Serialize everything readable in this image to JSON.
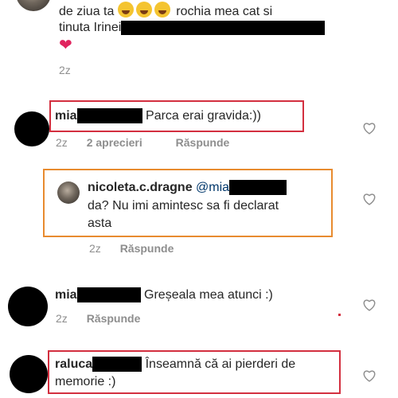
{
  "top_comment": {
    "line1_prefix": "de ziua ta",
    "line1_suffix": "rochia mea cat si",
    "line2": "tinuta Irinei",
    "heart": "❤",
    "time": "2z"
  },
  "comment_mia_1": {
    "username": "mia",
    "text": "Parca erai gravida:))",
    "time": "2z",
    "likes": "2 aprecieri",
    "reply": "Răspunde"
  },
  "reply_nicoleta": {
    "username": "nicoleta.c.dragne",
    "mention": "@mia",
    "line2": "da? Nu imi amintesc sa fi declarat",
    "line3": "asta",
    "time": "2z",
    "reply": "Răspunde"
  },
  "comment_mia_2": {
    "username": "mia",
    "text": "Greșeala mea atunci :)",
    "time": "2z",
    "reply": "Răspunde"
  },
  "comment_raluca": {
    "username": "raluca",
    "text_line1": "Înseamnă că ai pierderi de",
    "text_line2": "memorie :)"
  },
  "colors": {
    "highlight_red": "#d32f3f",
    "highlight_orange": "#e88b2f",
    "meta_gray": "#8e8e8e"
  },
  "icons": [
    "heart-outline-icon",
    "laughing-emoji-icon",
    "red-heart-icon"
  ]
}
